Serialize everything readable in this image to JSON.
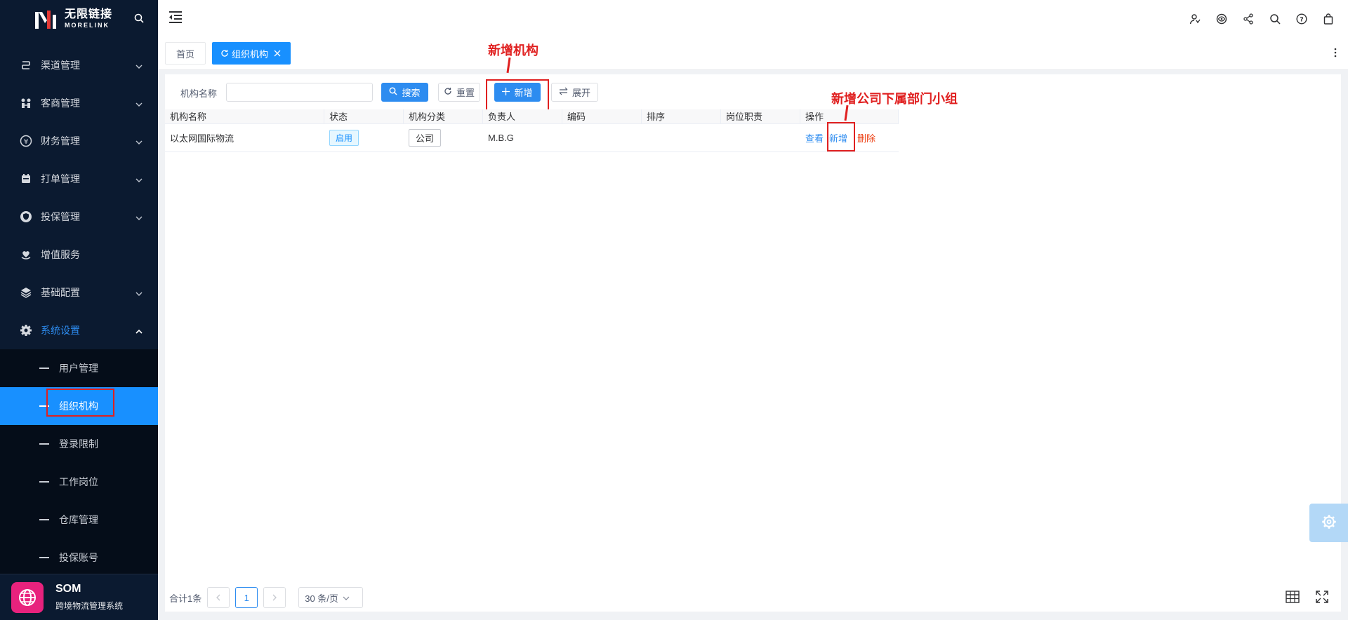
{
  "sidebar": {
    "logo_cn": "无限链接",
    "logo_en": "MORELINK",
    "menu": [
      {
        "label": "渠道管理"
      },
      {
        "label": "客商管理"
      },
      {
        "label": "财务管理"
      },
      {
        "label": "打单管理"
      },
      {
        "label": "投保管理"
      },
      {
        "label": "增值服务"
      },
      {
        "label": "基础配置"
      },
      {
        "label": "系统设置"
      }
    ],
    "submenu": [
      {
        "label": "用户管理"
      },
      {
        "label": "组织机构"
      },
      {
        "label": "登录限制"
      },
      {
        "label": "工作岗位"
      },
      {
        "label": "仓库管理"
      },
      {
        "label": "投保账号"
      }
    ],
    "brand_title": "SOM",
    "brand_subtitle": "跨境物流管理系统"
  },
  "tags": {
    "home": "首页",
    "current": "组织机构"
  },
  "search": {
    "label": "机构名称",
    "input_value": "",
    "search_btn": "搜索",
    "reset_btn": "重置",
    "add_btn": "新增",
    "expand_btn": "展开"
  },
  "table": {
    "headers": [
      "机构名称",
      "状态",
      "机构分类",
      "负责人",
      "编码",
      "排序",
      "岗位职责",
      "操作"
    ],
    "rows": [
      {
        "name": "以太网国际物流",
        "status": "启用",
        "category": "公司",
        "owner": "M.B.G",
        "code": "",
        "sort": "",
        "duty": "",
        "ops": [
          "查看",
          "新增",
          "删除"
        ]
      }
    ]
  },
  "pager": {
    "total": "合计1条",
    "page": "1",
    "page_size": "30 条/页"
  },
  "annotations": {
    "add_org": "新增机构",
    "add_sub": "新增公司下属部门小组"
  },
  "colors": {
    "sidebar_bg": "#0b1a30",
    "primary": "#1890ff",
    "annotation": "#e02020",
    "brand": "#e8227d"
  }
}
